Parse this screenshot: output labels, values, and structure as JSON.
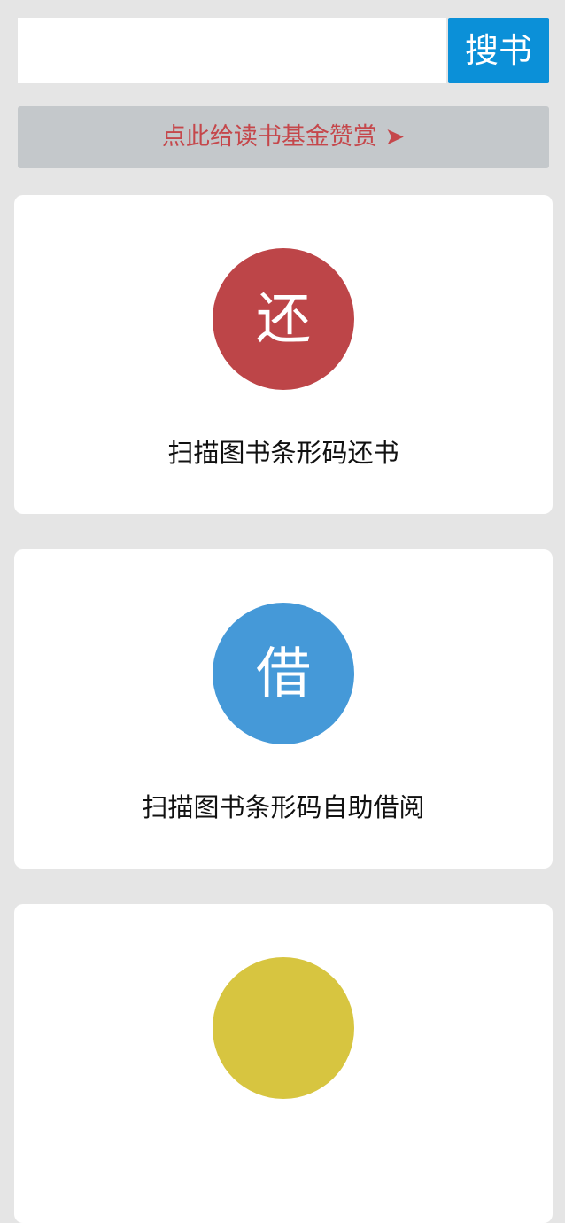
{
  "search": {
    "placeholder": "",
    "value": "",
    "button_label": "搜书"
  },
  "donate": {
    "label": "点此给读书基金赞赏 ➤"
  },
  "cards": [
    {
      "icon_text": "还",
      "label": "扫描图书条形码还书",
      "color": "#bd4548"
    },
    {
      "icon_text": "借",
      "label": "扫描图书条形码自助借阅",
      "color": "#4599d8"
    },
    {
      "icon_text": "",
      "label": "",
      "color": "#d7c540"
    }
  ],
  "colors": {
    "background": "#e5e5e5",
    "accent": "#0b90d8",
    "donate_text": "#c5474b",
    "donate_bg": "#c4c8cb"
  }
}
